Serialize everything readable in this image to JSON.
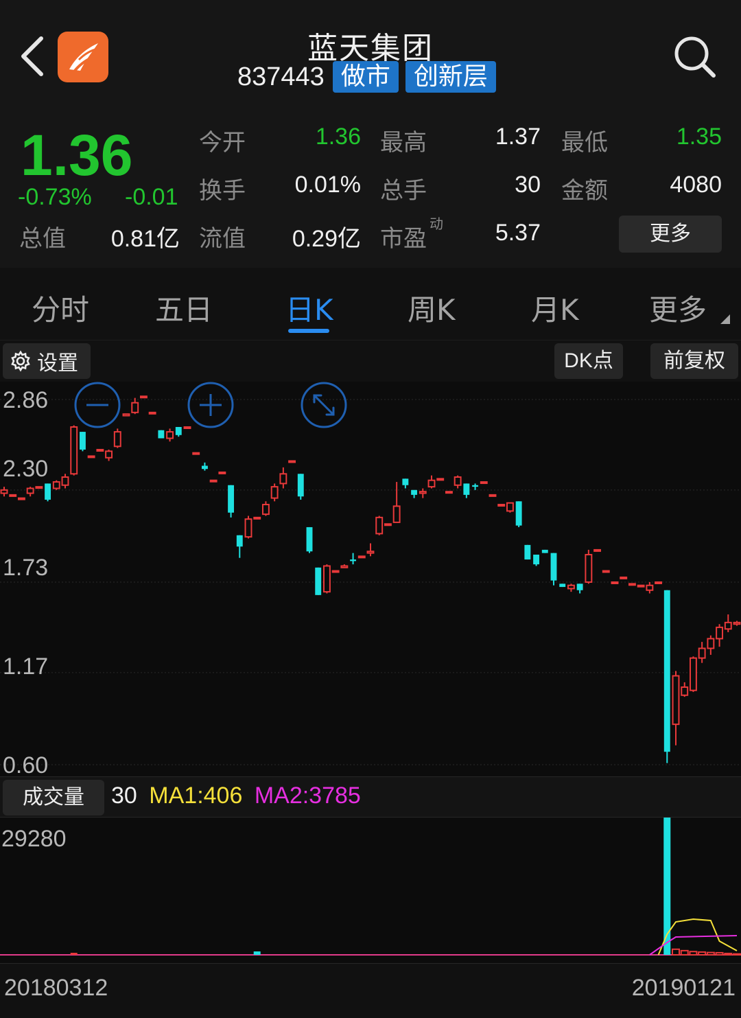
{
  "header": {
    "title": "蓝天集团",
    "code": "837443",
    "tags": [
      "做市",
      "创新层"
    ],
    "back_icon": "chevron-left-icon",
    "search_icon": "search-icon",
    "logo_icon": "app-logo-icon"
  },
  "quote": {
    "price": "1.36",
    "change_pct": "-0.73%",
    "change": "-0.01",
    "rows": [
      [
        {
          "label": "今开",
          "value": "1.36",
          "color": "green"
        },
        {
          "label": "最高",
          "value": "1.37"
        },
        {
          "label": "最低",
          "value": "1.35",
          "color": "green"
        }
      ],
      [
        {
          "label": "换手",
          "value": "0.01%"
        },
        {
          "label": "总手",
          "value": "30"
        },
        {
          "label": "金额",
          "value": "4080"
        }
      ]
    ],
    "total_value_label": "总值",
    "total_value": "0.81亿",
    "float_value_label": "流值",
    "float_value": "0.29亿",
    "pe_label": "市盈",
    "pe_sup": "动",
    "pe_value": "5.37",
    "more_label": "更多",
    "colors": {
      "up": "#e8393a",
      "down": "#22c52f",
      "accent": "#2a8cf0"
    }
  },
  "tabs": {
    "items": [
      "分时",
      "五日",
      "日K",
      "周K",
      "月K",
      "更多"
    ],
    "active": "日K"
  },
  "toolbar": {
    "settings_label": "设置",
    "dk_label": "DK点",
    "adjust_label": "前复权"
  },
  "chart_data": {
    "type": "candlestick",
    "y_ticks": [
      "2.86",
      "2.30",
      "1.73",
      "1.17",
      "0.60"
    ],
    "ylim": [
      0.6,
      2.86
    ],
    "start_date": "20180312",
    "end_date": "20190121",
    "candles": [
      [
        2.28,
        2.32,
        2.26,
        2.3
      ],
      [
        2.27,
        2.27,
        2.27,
        2.27
      ],
      [
        2.25,
        2.25,
        2.25,
        2.25
      ],
      [
        2.28,
        2.32,
        2.26,
        2.31
      ],
      [
        2.32,
        2.32,
        2.32,
        2.32
      ],
      [
        2.34,
        2.34,
        2.23,
        2.24
      ],
      [
        2.31,
        2.36,
        2.3,
        2.35
      ],
      [
        2.33,
        2.4,
        2.31,
        2.38
      ],
      [
        2.4,
        2.7,
        2.39,
        2.69
      ],
      [
        2.66,
        2.66,
        2.54,
        2.55
      ],
      [
        2.51,
        2.51,
        2.51,
        2.51
      ],
      [
        2.55,
        2.55,
        2.55,
        2.55
      ],
      [
        2.5,
        2.55,
        2.48,
        2.54
      ],
      [
        2.57,
        2.68,
        2.56,
        2.66
      ],
      [
        2.76,
        2.77,
        2.76,
        2.77
      ],
      [
        2.78,
        2.87,
        2.77,
        2.84
      ],
      [
        2.88,
        2.88,
        2.88,
        2.88
      ],
      [
        2.78,
        2.78,
        2.78,
        2.78
      ],
      [
        2.67,
        2.67,
        2.62,
        2.62
      ],
      [
        2.62,
        2.68,
        2.6,
        2.66
      ],
      [
        2.69,
        2.69,
        2.63,
        2.64
      ],
      [
        2.69,
        2.69,
        2.69,
        2.69
      ],
      [
        2.53,
        2.53,
        2.53,
        2.53
      ],
      [
        2.45,
        2.47,
        2.42,
        2.43
      ],
      [
        2.36,
        2.36,
        2.36,
        2.36
      ],
      [
        2.41,
        2.41,
        2.41,
        2.41
      ],
      [
        2.33,
        2.33,
        2.13,
        2.16
      ],
      [
        2.02,
        2.02,
        1.88,
        1.95
      ],
      [
        2.01,
        2.14,
        2.0,
        2.12
      ],
      [
        2.13,
        2.13,
        2.13,
        2.13
      ],
      [
        2.15,
        2.23,
        2.14,
        2.21
      ],
      [
        2.25,
        2.34,
        2.23,
        2.32
      ],
      [
        2.34,
        2.44,
        2.31,
        2.4
      ],
      [
        2.48,
        2.48,
        2.48,
        2.48
      ],
      [
        2.4,
        2.4,
        2.24,
        2.26
      ],
      [
        2.07,
        2.07,
        1.91,
        1.92
      ],
      [
        1.82,
        1.82,
        1.65,
        1.65
      ],
      [
        1.67,
        1.84,
        1.66,
        1.83
      ],
      [
        1.8,
        1.8,
        1.8,
        1.8
      ],
      [
        1.82,
        1.84,
        1.82,
        1.83
      ],
      [
        1.87,
        1.91,
        1.84,
        1.86
      ],
      [
        1.89,
        1.89,
        1.89,
        1.89
      ],
      [
        1.91,
        1.97,
        1.89,
        1.92
      ],
      [
        2.03,
        2.14,
        2.02,
        2.13
      ],
      [
        2.09,
        2.09,
        2.09,
        2.09
      ],
      [
        2.1,
        2.35,
        2.1,
        2.2
      ],
      [
        2.37,
        2.37,
        2.31,
        2.33
      ],
      [
        2.3,
        2.3,
        2.25,
        2.27
      ],
      [
        2.28,
        2.31,
        2.25,
        2.29
      ],
      [
        2.32,
        2.39,
        2.31,
        2.36
      ],
      [
        2.37,
        2.37,
        2.37,
        2.37
      ],
      [
        2.29,
        2.29,
        2.29,
        2.29
      ],
      [
        2.33,
        2.39,
        2.31,
        2.38
      ],
      [
        2.34,
        2.34,
        2.25,
        2.27
      ],
      [
        2.33,
        2.34,
        2.3,
        2.32
      ],
      [
        2.35,
        2.35,
        2.35,
        2.35
      ],
      [
        2.27,
        2.27,
        2.27,
        2.27
      ],
      [
        2.21,
        2.21,
        2.21,
        2.21
      ],
      [
        2.17,
        2.22,
        2.16,
        2.22
      ],
      [
        2.23,
        2.23,
        2.07,
        2.08
      ],
      [
        1.96,
        1.96,
        1.87,
        1.87
      ],
      [
        1.9,
        1.9,
        1.83,
        1.84
      ],
      [
        1.93,
        1.93,
        1.91,
        1.91
      ],
      [
        1.91,
        1.91,
        1.71,
        1.74
      ],
      [
        1.72,
        1.72,
        1.7,
        1.7
      ],
      [
        1.69,
        1.72,
        1.67,
        1.71
      ],
      [
        1.72,
        1.72,
        1.66,
        1.68
      ],
      [
        1.73,
        1.93,
        1.72,
        1.9
      ],
      [
        1.93,
        1.93,
        1.92,
        1.93
      ],
      [
        1.8,
        1.8,
        1.8,
        1.8
      ],
      [
        1.73,
        1.73,
        1.73,
        1.73
      ],
      [
        1.76,
        1.76,
        1.76,
        1.76
      ],
      [
        1.72,
        1.72,
        1.72,
        1.72
      ],
      [
        1.71,
        1.71,
        1.71,
        1.71
      ],
      [
        1.68,
        1.73,
        1.66,
        1.71
      ],
      [
        1.73,
        1.73,
        1.73,
        1.73
      ],
      [
        1.68,
        1.68,
        0.61,
        0.68
      ],
      [
        0.85,
        1.18,
        0.72,
        1.15
      ],
      [
        1.03,
        1.11,
        1.02,
        1.08
      ],
      [
        1.06,
        1.27,
        1.05,
        1.26
      ],
      [
        1.26,
        1.36,
        1.23,
        1.32
      ],
      [
        1.32,
        1.4,
        1.28,
        1.38
      ],
      [
        1.38,
        1.47,
        1.33,
        1.45
      ],
      [
        1.44,
        1.53,
        1.42,
        1.48
      ],
      [
        1.47,
        1.49,
        1.46,
        1.48
      ]
    ],
    "volume": {
      "label": "成交量",
      "latest": "30",
      "ma1_label": "MA1:406",
      "ma2_label": "MA2:3785",
      "max_label": "29280",
      "max": 29280,
      "spike_index": 76,
      "spike_value": 29280,
      "tail_values": [
        1200,
        900,
        700,
        600,
        500,
        450,
        300,
        200
      ]
    }
  },
  "zoom_controls": [
    "zoom-out-icon",
    "zoom-in-icon",
    "expand-icon"
  ]
}
